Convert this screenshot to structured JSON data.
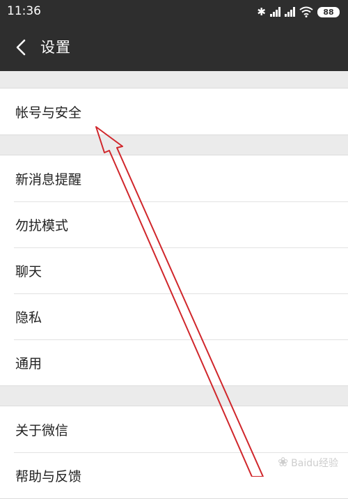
{
  "status": {
    "time": "11:36",
    "battery": "88"
  },
  "nav": {
    "title": "设置"
  },
  "groups": [
    {
      "items": [
        "帐号与安全"
      ]
    },
    {
      "items": [
        "新消息提醒",
        "勿扰模式",
        "聊天",
        "隐私",
        "通用"
      ]
    },
    {
      "items": [
        "关于微信",
        "帮助与反馈"
      ]
    }
  ],
  "watermark": {
    "text": "Baidu经验"
  },
  "colors": {
    "header": "#2e2e2e",
    "background": "#ebebeb",
    "annotation": "#d0262b"
  }
}
